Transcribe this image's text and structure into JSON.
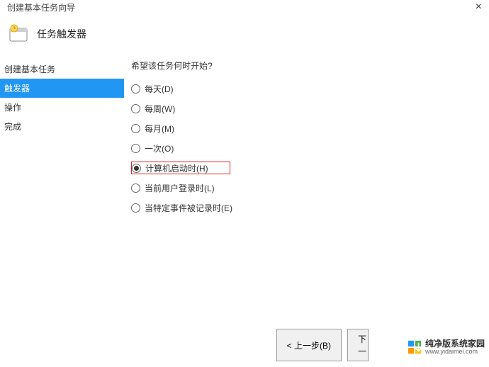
{
  "window": {
    "title": "创建基本任务向导",
    "close": "×"
  },
  "header": {
    "title": "任务触发器"
  },
  "sidebar": {
    "items": [
      {
        "label": "创建基本任务"
      },
      {
        "label": "触发器"
      },
      {
        "label": "操作"
      },
      {
        "label": "完成"
      }
    ]
  },
  "main": {
    "prompt": "希望该任务何时开始?",
    "options": [
      {
        "label": "每天(D)"
      },
      {
        "label": "每周(W)"
      },
      {
        "label": "每月(M)"
      },
      {
        "label": "一次(O)"
      },
      {
        "label": "计算机启动时(H)"
      },
      {
        "label": "当前用户登录时(L)"
      },
      {
        "label": "当特定事件被记录时(E)"
      }
    ]
  },
  "buttons": {
    "back": "< 上一步(B)",
    "next": "下一"
  },
  "watermark": {
    "cn": "纯净版系统家园",
    "url": "www.yidaimei.com"
  }
}
